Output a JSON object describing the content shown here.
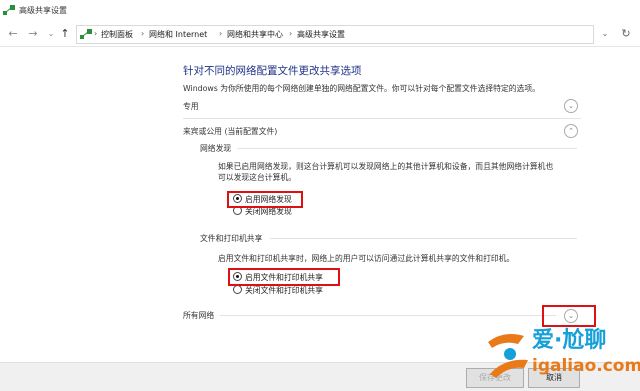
{
  "window": {
    "title": "高级共享设置"
  },
  "nav": {
    "back": "←",
    "forward": "→",
    "history": "⌄",
    "up": "↑",
    "breadcrumbs": [
      "控制面板",
      "网络和 Internet",
      "网络和共享中心",
      "高级共享设置"
    ],
    "separator": "›",
    "dropdown": "⌄",
    "refresh": "↻"
  },
  "content": {
    "heading": "针对不同的网络配置文件更改共享选项",
    "description": "Windows 为你所使用的每个网络创建单独的网络配置文件。你可以针对每个配置文件选择特定的选项。",
    "profiles": {
      "private": {
        "label": "专用",
        "chevron": "⌄"
      },
      "guest": {
        "label": "来宾或公用 (当前配置文件)",
        "chevron": "⌃",
        "network_discovery": {
          "title": "网络发现",
          "text_line1": "如果已启用网络发现，则这台计算机可以发现网络上的其他计算机和设备，而且其他网络计算机也",
          "text_line2": "可以发现这台计算机。",
          "options": [
            {
              "label": "启用网络发现",
              "checked": true
            },
            {
              "label": "关闭网络发现",
              "checked": false
            }
          ]
        },
        "file_printer": {
          "title": "文件和打印机共享",
          "text": "启用文件和打印机共享时，网络上的用户可以访问通过此计算机共享的文件和打印机。",
          "options": [
            {
              "label": "启用文件和打印机共享",
              "checked": true
            },
            {
              "label": "关闭文件和打印机共享",
              "checked": false
            }
          ]
        }
      },
      "all": {
        "label": "所有网络",
        "chevron": "⌄"
      }
    }
  },
  "footer": {
    "save": "保存更改",
    "cancel": "取消"
  },
  "watermark": {
    "brand": "爱·尬聊",
    "url": "igaliao.com"
  },
  "colors": {
    "heading": "#1e3287",
    "highlight": "#dd1111",
    "brand_blue": "#16a0d8",
    "brand_orange": "#e97a19"
  }
}
